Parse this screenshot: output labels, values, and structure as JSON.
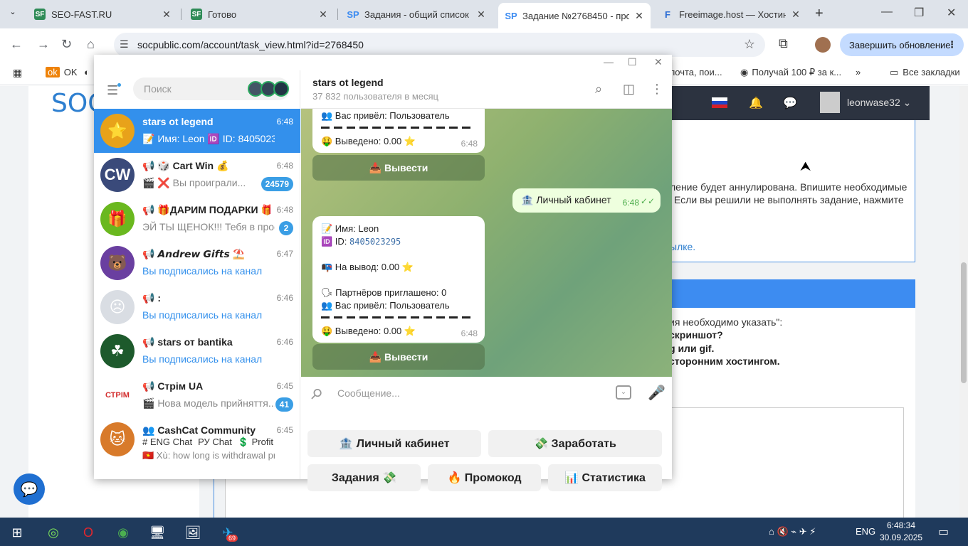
{
  "browser": {
    "tabs": [
      {
        "title": "SEO-FAST.RU",
        "favicon": "SF"
      },
      {
        "title": "Готово",
        "favicon": "SF"
      },
      {
        "title": "Задания - общий список за",
        "favicon": "SP"
      },
      {
        "title": "Задание №2768450 - прос",
        "favicon": "SP"
      },
      {
        "title": "Freeimage.host — Хостинг",
        "favicon": "F"
      }
    ],
    "url": "socpublic.com/account/task_view.html?id=2768450",
    "update_label": "Завершить обновление",
    "bookmarks": [
      {
        "label": "OK"
      },
      {
        "label": ": почта, пои..."
      },
      {
        "label": "Получай 100 ₽ за к..."
      },
      {
        "label": "Все закладки"
      }
    ]
  },
  "site": {
    "logo": "SOC",
    "username": "leonwase32",
    "notice_lines": [
      "ление будет аннулирована. Впишите необходимые",
      "Если вы решили не выполнять задание, нажмите",
      "ылке."
    ],
    "req_lines": [
      "ия необходимо указать\":",
      "скриншот?",
      "g или gif.",
      "сторонним хостингом."
    ]
  },
  "telegram": {
    "search_placeholder": "Поиск",
    "chats": [
      {
        "name": "stars ot legend",
        "time": "6:48",
        "preview": "📝 Имя: Leon 🆔 ID: 84050232...",
        "badge": "",
        "avatar": "⭐",
        "avatar_color": "#e8a21a",
        "active": true
      },
      {
        "name": "📢 🎲 Cart Win 💰",
        "time": "6:48",
        "preview": "🎬 ❌ Вы проиграли...",
        "badge": "24579",
        "avatar": "CW",
        "avatar_color": "#3a4a7a",
        "active": false
      },
      {
        "name": "📢 🎁ДАРИМ ПОДАРКИ 🎁",
        "time": "6:48",
        "preview": "ЭЙ ТЫ ЩЕНОК!!! Тебя в проф...",
        "badge": "2",
        "avatar": "🎁",
        "avatar_color": "#6ab81f",
        "active": false
      },
      {
        "name": "📢 𝘼𝙣𝙙𝙧𝙚𝙬 𝙂𝙞𝙛𝙩𝙨 ⛱️",
        "time": "6:47",
        "preview": "Вы подписались на канал",
        "badge": "",
        "avatar": "🐻",
        "avatar_color": "#6a3fa0",
        "active": false
      },
      {
        "name": "📢 :",
        "time": "6:46",
        "preview": "Вы подписались на канал",
        "badge": "",
        "avatar": "☹",
        "avatar_color": "#d9dde3",
        "active": false
      },
      {
        "name": "📢 stars от bantika",
        "time": "6:46",
        "preview": "Вы подписались на канал",
        "badge": "",
        "avatar": "☘",
        "avatar_color": "#1d5a2c",
        "active": false
      },
      {
        "name": "📢 Стрім UA",
        "time": "6:45",
        "preview": "🎬 Нова модель прийняття...",
        "badge": "41",
        "avatar": "СТРІМ",
        "avatar_color": "#ffffff",
        "active": false
      },
      {
        "name": "👥 CashCat Community",
        "time": "6:45",
        "preview": "🇻🇳 Xù: how long is withdrawal pr...",
        "badge": "",
        "avatar": "🐱",
        "avatar_color": "#d87a2a",
        "active": false
      }
    ],
    "cashcat_chips": [
      "# ENG Chat",
      "РУ Chat",
      "💲 Profit ..."
    ],
    "channel_title": "stars ot legend",
    "channel_sub": "37 832 пользователя в месяц",
    "msg1": {
      "ref": "👥 Вас привёл: Пользователь",
      "withdrawn": "🤑 Выведено: 0.00 ⭐",
      "time": "6:48"
    },
    "withdraw_btn": "📥 Вывести",
    "out_msg": {
      "text": "🏦 Личный кабинет",
      "time": "6:48"
    },
    "msg2": {
      "name": "📝 Имя: Leon",
      "id_label": "🆔 ID: ",
      "id_value": "8405023295",
      "payout": "📭 На вывод: 0.00 ⭐",
      "partners": "🗣 Партнёров приглашено: 0",
      "ref": "👥 Вас привёл: Пользователь",
      "withdrawn": "🤑 Выведено: 0.00 ⭐",
      "time": "6:48"
    },
    "input_placeholder": "Сообщение...",
    "keyboard": {
      "row1": [
        "🏦 Личный кабинет",
        "💸 Заработать"
      ],
      "row2": [
        "Задания 💸",
        "🔥 Промокод",
        "📊 Статистика"
      ]
    }
  },
  "taskbar": {
    "lang": "ENG",
    "time": "6:48:34",
    "date": "30.09.2025",
    "telegram_badge": "69"
  }
}
